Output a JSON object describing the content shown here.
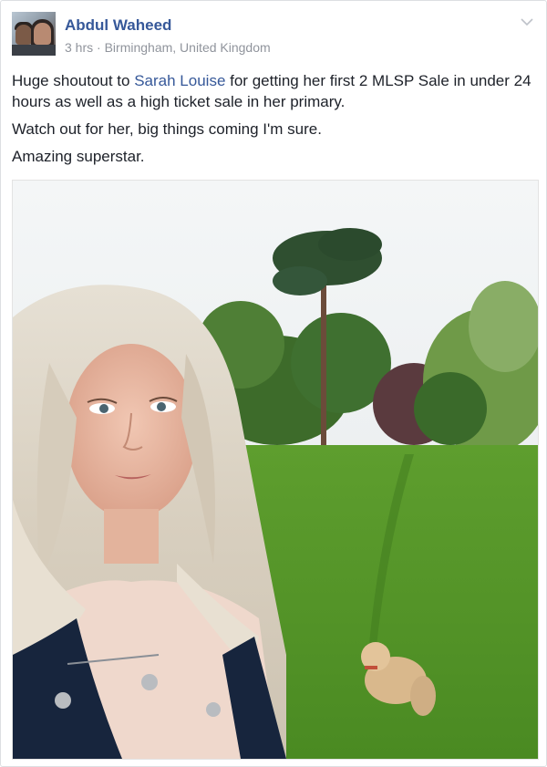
{
  "post": {
    "author_name": "Abdul Waheed",
    "time": "3 hrs",
    "separator": " · ",
    "location": "Birmingham, United Kingdom",
    "paragraphs": [
      {
        "before": "Huge shoutout to ",
        "mention": "Sarah Louise",
        "after": " for getting her first 2 MLSP Sale in under 24 hours as well as a high ticket sale in her primary."
      },
      {
        "text": "Watch out for her, big things coming I'm sure."
      },
      {
        "text": "Amazing superstar."
      }
    ],
    "icons": {
      "avatar": "author-avatar",
      "options": "chevron-down-icon"
    },
    "colors": {
      "link": "#365899",
      "meta": "#90949c",
      "text": "#1d2129"
    }
  }
}
